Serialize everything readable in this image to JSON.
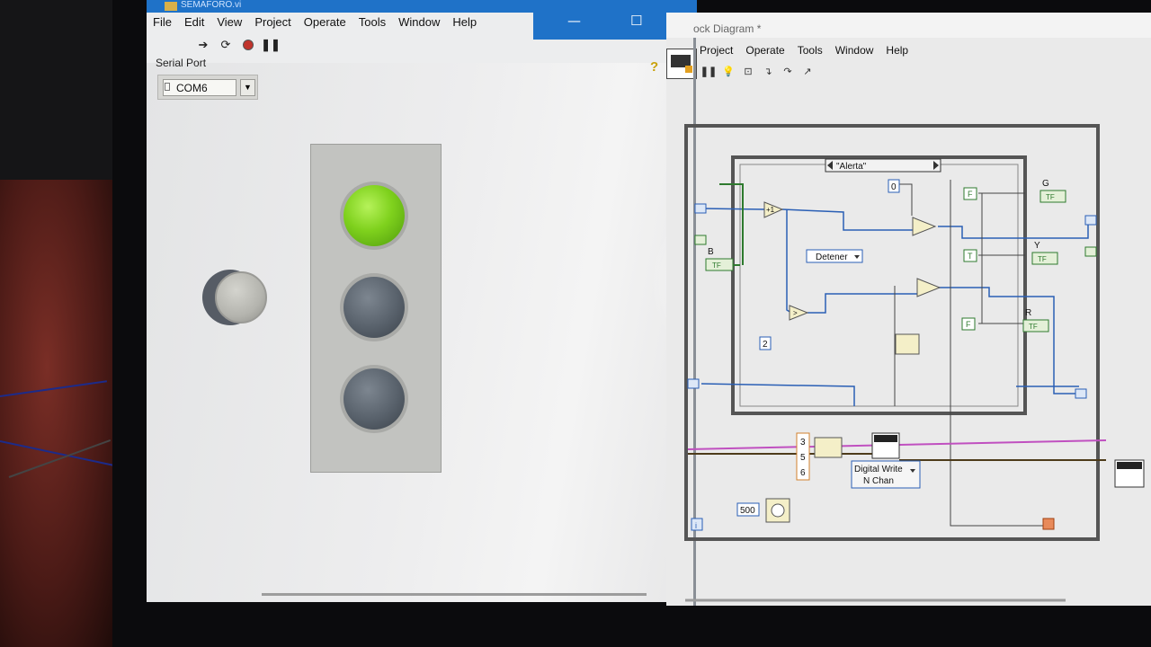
{
  "front_panel": {
    "window_title": "SEMAFORO.vi",
    "menu": [
      "File",
      "Edit",
      "View",
      "Project",
      "Operate",
      "Tools",
      "Window",
      "Help"
    ],
    "toolbar_icons": [
      "run-arrow-icon",
      "run-continuously-icon",
      "abort-icon",
      "pause-icon"
    ],
    "serial_port": {
      "label": "Serial Port",
      "value": "COM6"
    },
    "stop_button": {
      "state": "off"
    },
    "traffic_light": {
      "green": "on",
      "yellow": "off",
      "red": "off"
    },
    "colors": {
      "lamp_on": "#7fd11d",
      "lamp_off": "#58616b",
      "titlebar": "#1f72c8"
    }
  },
  "block_diagram": {
    "window_title": "ock Diagram *",
    "menu": [
      "Project",
      "Operate",
      "Tools",
      "Window",
      "Help"
    ],
    "toolbar_icons": [
      "pause-icon",
      "highlight-execution-icon",
      "retain-wire-values-icon",
      "step-into-icon",
      "step-over-icon",
      "step-out-icon"
    ],
    "case_selector": "\"Alerta\"",
    "enum_constant": "Detener",
    "constants": {
      "zero": "0",
      "two": "2",
      "array": [
        "3",
        "5",
        "6"
      ],
      "wait_ms": "500"
    },
    "bool_constants": [
      "F",
      "T",
      "F"
    ],
    "indicators": {
      "green": "G",
      "yellow": "Y",
      "red": "R",
      "button": "B"
    },
    "indicator_label": "TF",
    "subvi": {
      "line1": "Digital Write",
      "line2": "N Chan"
    },
    "iteration_terminal": "i"
  }
}
